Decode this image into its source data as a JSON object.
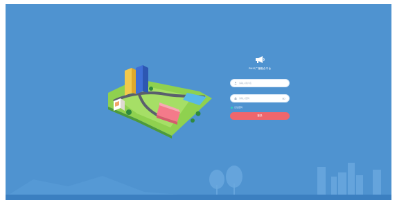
{
  "login": {
    "title": "PMIS广播融合平台",
    "username_placeholder": "请输入用户名",
    "password_placeholder": "请输入密码",
    "remember_label": "记住密码",
    "submit_label": "登录"
  },
  "footer": {
    "text": ""
  },
  "colors": {
    "background": "#4f93d0",
    "button": "#f0666c",
    "checkbox": "#2fd0c0"
  },
  "icons": [
    "megaphone-icon",
    "user-icon",
    "lock-icon",
    "eye-icon",
    "city-illustration",
    "skyline-decoration"
  ]
}
